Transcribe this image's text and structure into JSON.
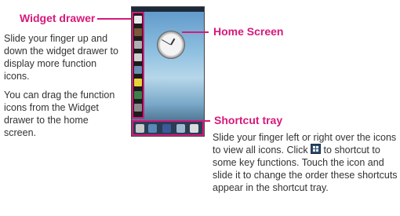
{
  "widget_drawer": {
    "heading": "Widget drawer",
    "paragraph1": "Slide your finger up and down the widget drawer to display more function icons.",
    "paragraph2": "You can drag the function icons from the Widget drawer to the home screen."
  },
  "home_screen": {
    "heading": "Home Screen"
  },
  "shortcut_tray": {
    "heading": "Shortcut tray",
    "text_before_icon": "Slide your finger left or right over the icons to view all icons. Click",
    "text_after_icon": "to shortcut to some key functions. Touch the icon and slide it to change the order these shortcuts appear in the shortcut tray.",
    "inline_icon": "grid-icon"
  },
  "colors": {
    "accent": "#d6197a",
    "body_text": "#333333"
  }
}
